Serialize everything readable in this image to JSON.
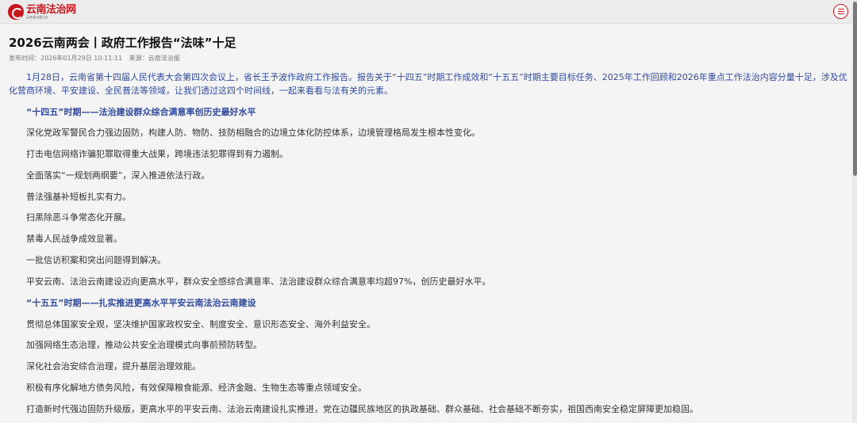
{
  "header": {
    "logo_title": "云南法治网",
    "logo_sub": "云南政法委主办"
  },
  "article": {
    "title": "2026云南两会丨政府工作报告“法味”十足",
    "publish_label": "发布时间：",
    "publish_time": "2026年01月29日 10:11:11",
    "source_label": "来源：",
    "source": "云南法治报",
    "intro": "1月28日，云南省第十四届人民代表大会第四次会议上，省长王予波作政府工作报告。报告关于“十四五”时期工作成效和“十五五”时期主要目标任务、2025年工作回顾和2026年重点工作法治内容分量十足，涉及优化营商环境、平安建设、全民普法等领域，让我们透过这四个时间线，一起来看看与法有关的元素。",
    "section1_heading": "“十四五”时期——法治建设群众综合满意率创历史最好水平",
    "section1_items": [
      "深化党政军警民合力强边固防，构建人防、物防、技防相融合的边境立体化防控体系，边境管理格局发生根本性变化。",
      "打击电信网络诈骗犯罪取得重大战果，跨境违法犯罪得到有力遏制。",
      "全面落实“一规划两纲要”，深入推进依法行政。",
      "普法强基补短板扎实有力。",
      "扫黑除恶斗争常态化开展。",
      "禁毒人民战争成效显著。",
      "一批信访积案和突出问题得到解决。",
      "平安云南、法治云南建设迈向更高水平，群众安全感综合满意率、法治建设群众综合满意率均超97%，创历史最好水平。"
    ],
    "section2_heading": "“十五五”时期——扎实推进更高水平平安云南法治云南建设",
    "section2_items": [
      "贯彻总体国家安全观，坚决维护国家政权安全、制度安全、意识形态安全、海外利益安全。",
      "加强网络生态治理，推动公共安全治理模式向事前预防转型。",
      "深化社会治安综合治理，提升基层治理效能。",
      "积极有序化解地方债务风险，有效保障粮食能源、经济金融、生物生态等重点领域安全。",
      "打造新时代强边固防升级版，更高水平的平安云南、法治云南建设扎实推进，党在边疆民族地区的执政基础、群众基础、社会基础不断夯实，祖国西南安全稳定屏障更加稳固。"
    ]
  }
}
